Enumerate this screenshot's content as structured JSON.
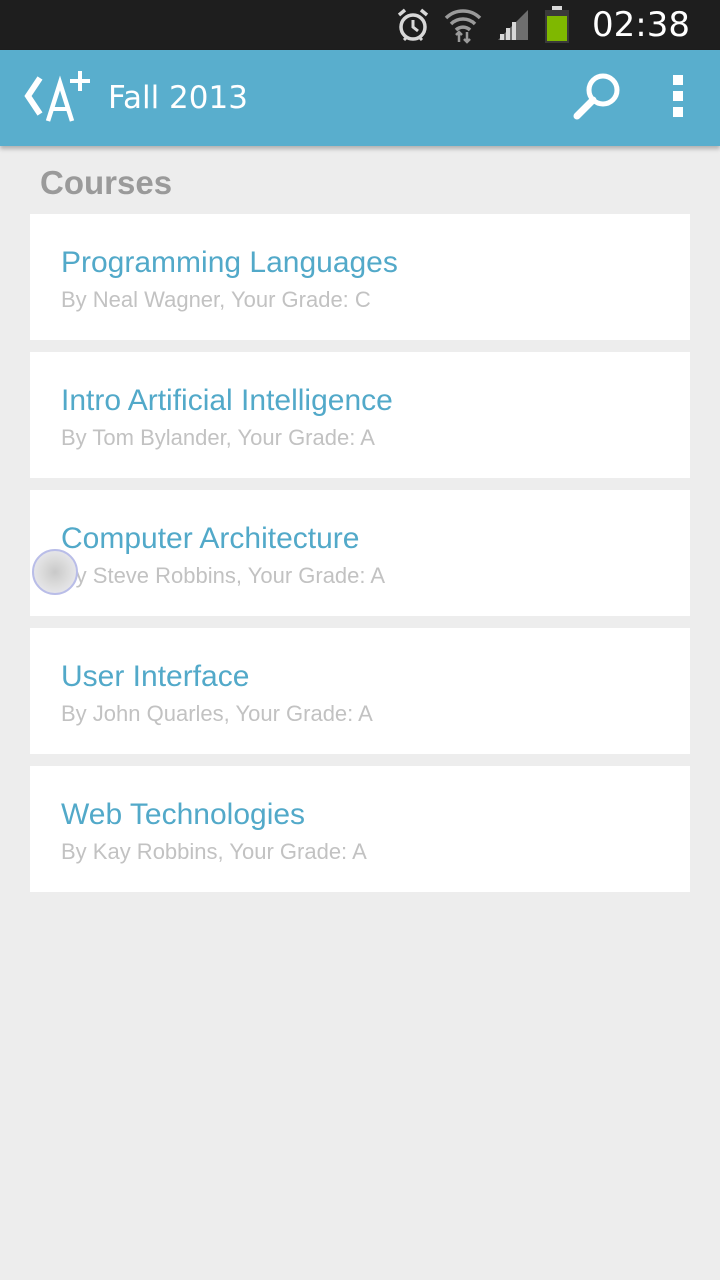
{
  "status_bar": {
    "time": "02:38",
    "icons": [
      "alarm-clock-icon",
      "wifi-icon",
      "signal-icon",
      "battery-icon"
    ],
    "battery_color": "#7fb800"
  },
  "action_bar": {
    "title": "Fall 2013",
    "logo": "a-plus-logo-icon",
    "actions": [
      "search-icon",
      "overflow-menu-icon"
    ],
    "color": "#59aecd"
  },
  "section": {
    "heading": "Courses"
  },
  "courses": [
    {
      "title": "Programming Languages",
      "subtitle": "By Neal Wagner, Your Grade: C"
    },
    {
      "title": "Intro Artificial Intelligence",
      "subtitle": "By Tom Bylander, Your Grade: A"
    },
    {
      "title": "Computer Architecture",
      "subtitle": "By Steve Robbins, Your Grade: A"
    },
    {
      "title": "User Interface",
      "subtitle": "By John Quarles, Your Grade: A"
    },
    {
      "title": "Web Technologies",
      "subtitle": "By Kay Robbins, Your Grade: A"
    }
  ],
  "colors": {
    "accent": "#52a9c9",
    "background": "#ededed",
    "heading": "#9a9a9a",
    "subtitle": "#c2c2c2"
  }
}
